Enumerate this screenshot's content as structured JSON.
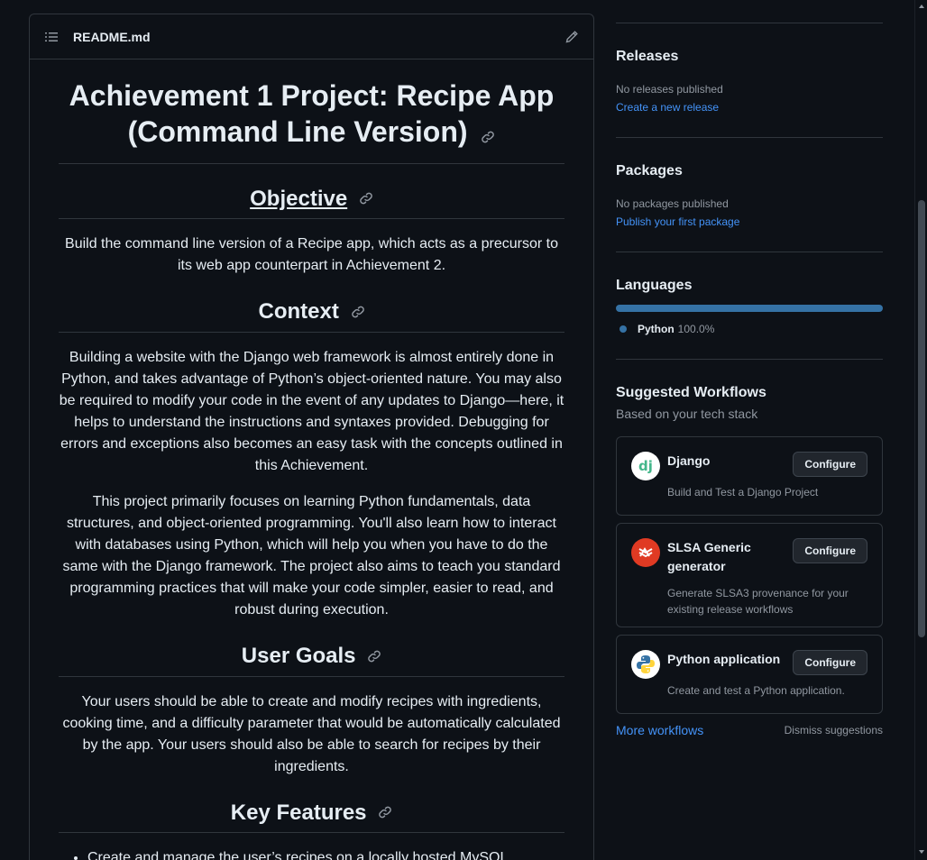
{
  "readme": {
    "filename": "README.md",
    "title": "Achievement 1 Project: Recipe App (Command Line Version)",
    "sections": {
      "objective": {
        "heading": "Objective",
        "body": "Build the command line version of a Recipe app, which acts as a precursor to its web app counterpart in Achievement 2."
      },
      "context": {
        "heading": "Context",
        "p1": "Building a website with the Django web framework is almost entirely done in Python, and takes advantage of Python’s object-oriented nature. You may also be required to modify your code in the event of any updates to Django—here, it helps to understand the instructions and syntaxes provided. Debugging for errors and exceptions also becomes an easy task with the concepts outlined in this Achievement.",
        "p2": "This project primarily focuses on learning Python fundamentals, data structures, and object-oriented programming. You'll also learn how to interact with databases using Python, which will help you when you have to do the same with the Django framework. The project also aims to teach you standard programming practices that will make your code simpler, easier to read, and robust during execution."
      },
      "user_goals": {
        "heading": "User Goals",
        "body": "Your users should be able to create and modify recipes with ingredients, cooking time, and a difficulty parameter that would be automatically calculated by the app. Your users should also be able to search for recipes by their ingredients."
      },
      "key_features": {
        "heading": "Key Features",
        "items": [
          "Create and manage the user’s recipes on a locally hosted MySQL database."
        ]
      }
    }
  },
  "sidebar": {
    "releases": {
      "title": "Releases",
      "status": "No releases published",
      "link": "Create a new release"
    },
    "packages": {
      "title": "Packages",
      "status": "No packages published",
      "link": "Publish your first package"
    },
    "languages": {
      "title": "Languages",
      "items": [
        {
          "name": "Python",
          "percent": "100.0%",
          "color": "#3572a5",
          "share": 1.0
        }
      ]
    },
    "workflows": {
      "title": "Suggested Workflows",
      "subtitle": "Based on your tech stack",
      "cards": [
        {
          "name": "Django",
          "desc": "Build and Test a Django Project",
          "button": "Configure",
          "icon": "django-icon"
        },
        {
          "name": "SLSA Generic generator",
          "desc": "Generate SLSA3 provenance for your existing release workflows",
          "button": "Configure",
          "icon": "slsa-icon"
        },
        {
          "name": "Python application",
          "desc": "Create and test a Python application.",
          "button": "Configure",
          "icon": "python-icon"
        }
      ],
      "more": "More workflows",
      "dismiss": "Dismiss suggestions"
    }
  },
  "colors": {
    "background": "#0d1117",
    "border": "#30363d",
    "link": "#4493f8",
    "muted": "#9198a1",
    "python": "#3572a5"
  }
}
